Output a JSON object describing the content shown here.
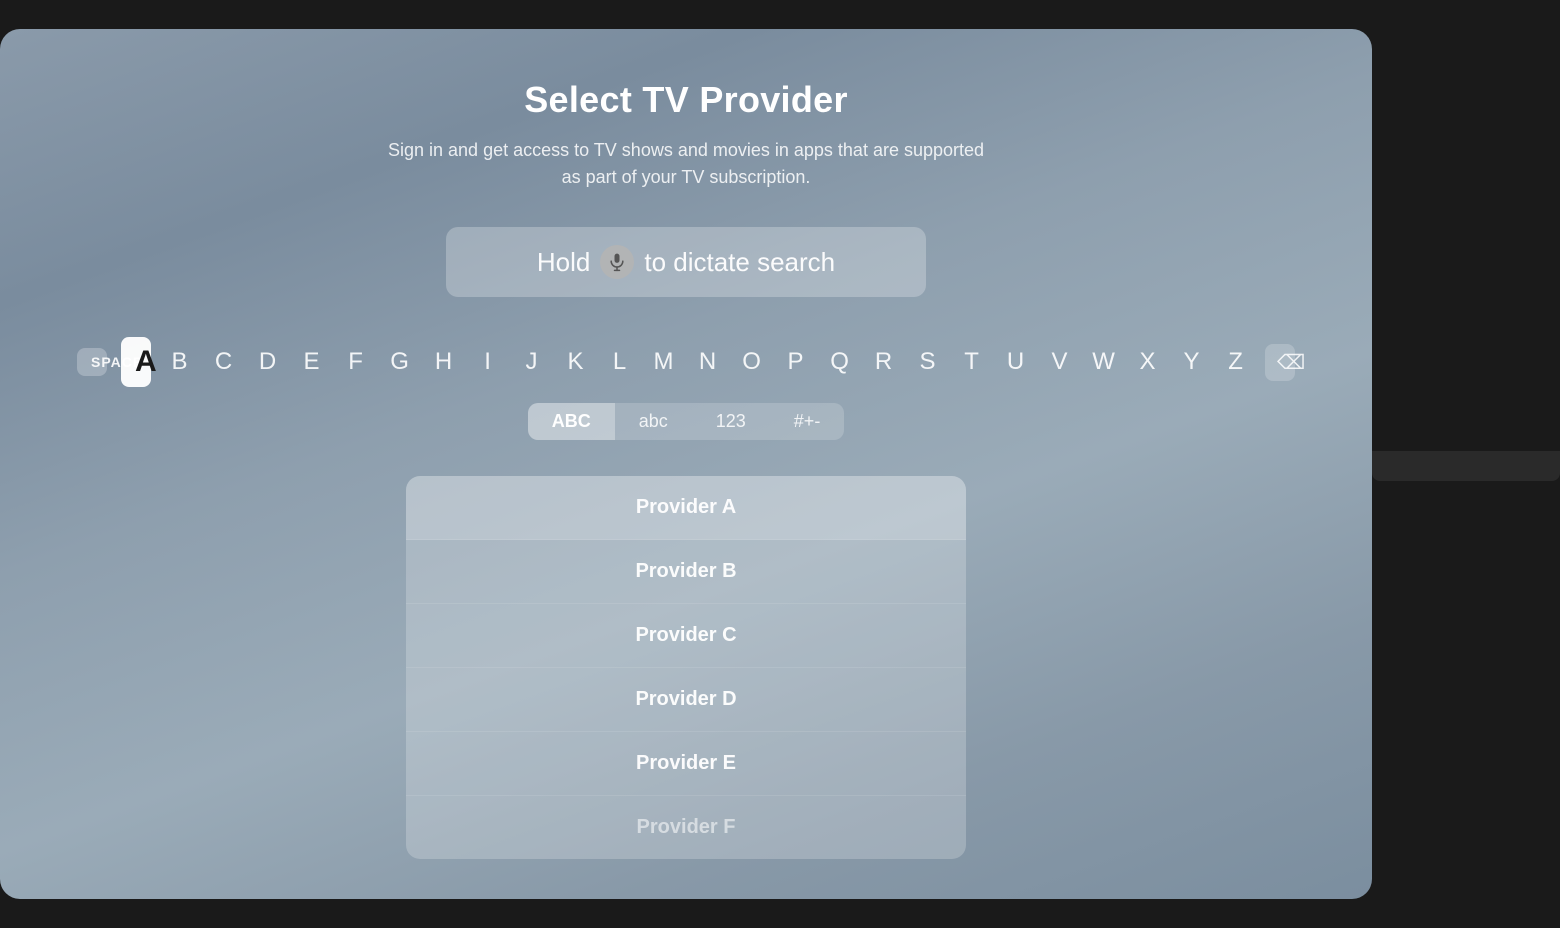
{
  "page": {
    "title": "Select TV Provider",
    "subtitle": "Sign in and get access to TV shows and movies in apps that are supported as part of your TV subscription."
  },
  "dictate": {
    "text_before": "Hold",
    "text_after": "to dictate search",
    "mic_label": "microphone-icon"
  },
  "keyboard": {
    "space_label": "SPACE",
    "active_key": "A",
    "letters": [
      "B",
      "C",
      "D",
      "E",
      "F",
      "G",
      "H",
      "I",
      "J",
      "K",
      "L",
      "M",
      "N",
      "O",
      "P",
      "Q",
      "R",
      "S",
      "T",
      "U",
      "V",
      "W",
      "X",
      "Y",
      "Z"
    ],
    "backspace_label": "⌫",
    "modes": [
      {
        "label": "ABC",
        "active": true
      },
      {
        "label": "abc",
        "active": false
      },
      {
        "label": "123",
        "active": false
      },
      {
        "label": "#+-",
        "active": false
      }
    ]
  },
  "providers": [
    {
      "name": "Provider A"
    },
    {
      "name": "Provider B"
    },
    {
      "name": "Provider C"
    },
    {
      "name": "Provider D"
    },
    {
      "name": "Provider E"
    },
    {
      "name": "Provider F"
    }
  ]
}
